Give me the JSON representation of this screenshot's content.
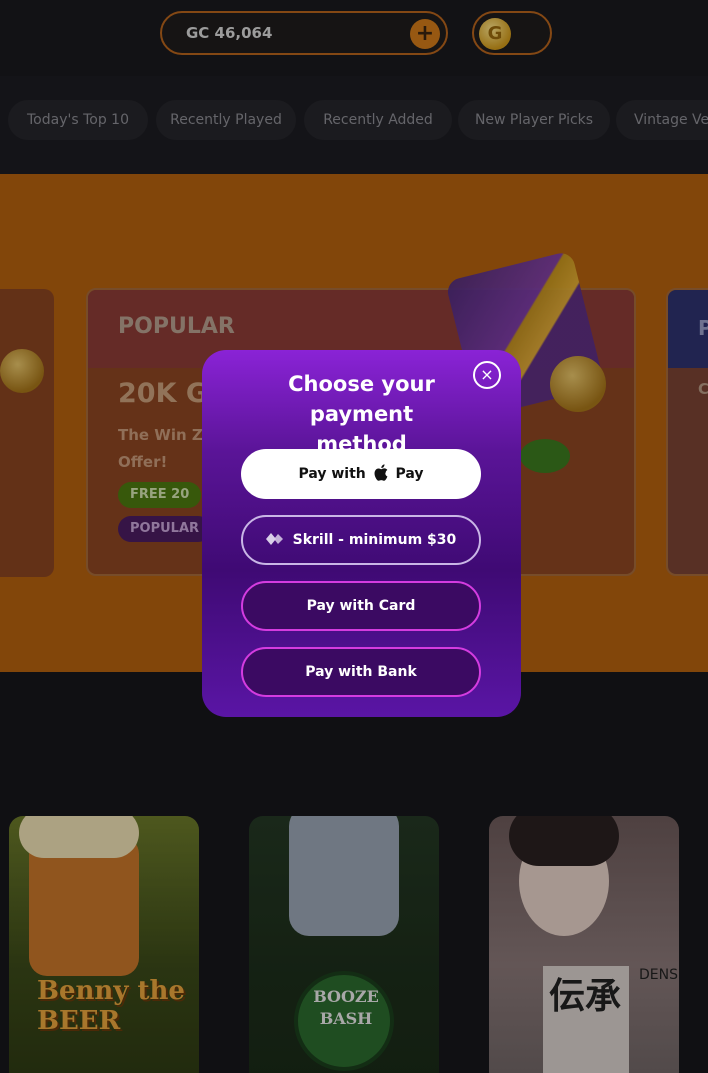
{
  "header": {
    "gc_balance": "GC 46,064",
    "add_icon_glyph": "+",
    "coin_icon_glyph": "G"
  },
  "tabs": [
    {
      "label": "Today's Top 10"
    },
    {
      "label": "Recently Played"
    },
    {
      "label": "Recently Added"
    },
    {
      "label": "New Player Picks"
    },
    {
      "label": "Vintage Ve"
    }
  ],
  "promo": {
    "title": "POPULAR",
    "amount": "20K G",
    "description": "The Win Ze Offer!",
    "badge_free": "FREE 20",
    "badge_popular": "POPULAR",
    "right_card_letter": "P",
    "right_card_sub": "C"
  },
  "modal": {
    "title": "Choose your payment method",
    "close_glyph": "×",
    "apple_prefix": "Pay with",
    "apple_suffix": "Pay",
    "skrill_label": "Skrill - minimum $30",
    "card_label": "Pay with Card",
    "bank_label": "Pay with Bank"
  },
  "games": [
    {
      "title": "Benny the BEER"
    },
    {
      "title": "BOOZE BASH"
    },
    {
      "title": "伝承",
      "subtitle": "DENSHO"
    }
  ],
  "colors": {
    "accent_orange": "#d17a1a",
    "modal_purple": "#5a1497",
    "button_magenta": "#d43ce0"
  }
}
